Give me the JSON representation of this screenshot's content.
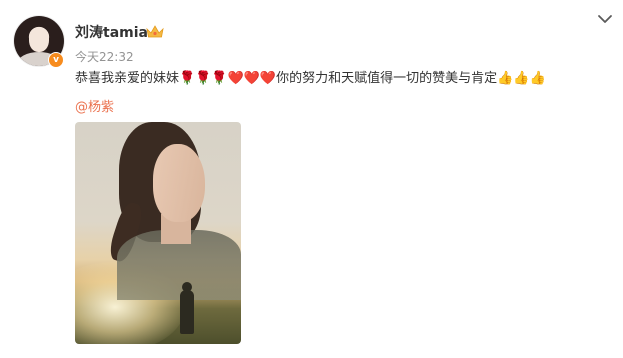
{
  "user": {
    "name": "刘涛tamia",
    "verified_badge": "v",
    "avatar_icon": "avatar-photo",
    "membership_icon": "crown-icon"
  },
  "post": {
    "time": "今天22:32",
    "text": "恭喜我亲爱的妹妹🌹🌹🌹❤️❤️❤️你的努力和天赋值得一切的赞美与肯定👍👍👍",
    "mention": "@杨紫"
  },
  "controls": {
    "more_icon": "chevron-down-icon"
  },
  "poster": {
    "description_icon": "movie-poster-image"
  },
  "colors": {
    "mention": "#eb7350",
    "username": "#333333",
    "time": "#939393",
    "badge": "#f78c1e"
  }
}
